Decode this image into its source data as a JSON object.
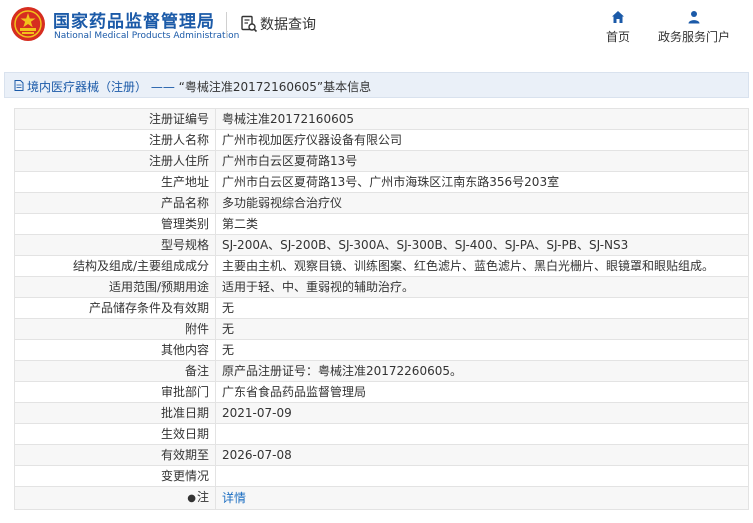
{
  "header": {
    "brand_cn": "国家药品监督管理局",
    "brand_en": "National Medical Products Administration",
    "query_title": "数据查询",
    "nav": {
      "home": "首页",
      "gov": "政务服务门户"
    },
    "colors": {
      "brand_blue": "#1b5aa8",
      "emblem_red": "#d62d20",
      "emblem_gold": "#f2c21b"
    }
  },
  "breadcrumb": {
    "section": "境内医疗器械（注册）",
    "sep": "——",
    "record": "“粤械注准20172160605”基本信息"
  },
  "detail": {
    "rows": [
      {
        "label": "注册证编号",
        "value": "粤械注准20172160605"
      },
      {
        "label": "注册人名称",
        "value": "广州市视加医疗仪器设备有限公司"
      },
      {
        "label": "注册人住所",
        "value": "广州市白云区夏荷路13号"
      },
      {
        "label": "生产地址",
        "value": "广州市白云区夏荷路13号、广州市海珠区江南东路356号203室"
      },
      {
        "label": "产品名称",
        "value": "多功能弱视综合治疗仪"
      },
      {
        "label": "管理类别",
        "value": "第二类"
      },
      {
        "label": "型号规格",
        "value": "SJ-200A、SJ-200B、SJ-300A、SJ-300B、SJ-400、SJ-PA、SJ-PB、SJ-NS3"
      },
      {
        "label": "结构及组成/主要组成成分",
        "value": "主要由主机、观察目镜、训练图案、红色滤片、蓝色滤片、黑白光栅片、眼镜罩和眼贴组成。"
      },
      {
        "label": "适用范围/预期用途",
        "value": "适用于轻、中、重弱视的辅助治疗。"
      },
      {
        "label": "产品储存条件及有效期",
        "value": "无"
      },
      {
        "label": "附件",
        "value": "无"
      },
      {
        "label": "其他内容",
        "value": "无"
      },
      {
        "label": "备注",
        "value": "原产品注册证号：粤械注准20172260605。"
      },
      {
        "label": "审批部门",
        "value": "广东省食品药品监督管理局"
      },
      {
        "label": "批准日期",
        "value": "2021-07-09"
      },
      {
        "label": "生效日期",
        "value": ""
      },
      {
        "label": "有效期至",
        "value": "2026-07-08"
      },
      {
        "label": "变更情况",
        "value": ""
      }
    ],
    "note_label": "注",
    "note_link": "详情"
  }
}
